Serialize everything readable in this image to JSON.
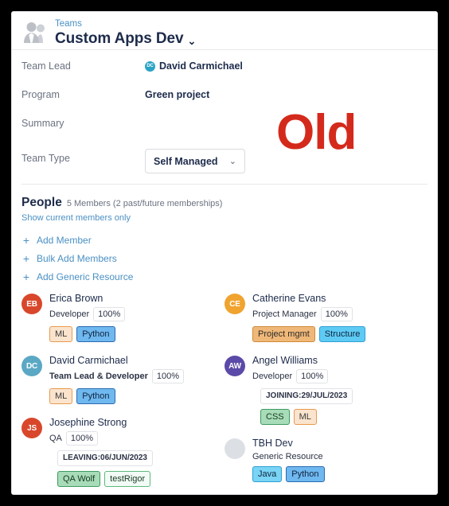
{
  "header": {
    "icon": "people-group-icon",
    "breadcrumb": "Teams",
    "title": "Custom Apps Dev",
    "chevron": "⌄"
  },
  "watermark": {
    "text": "Old",
    "color": "#d42a1c"
  },
  "fields": {
    "team_lead": {
      "label": "Team Lead",
      "avatar_initials": "DC",
      "avatar_color": "#2aa3c4",
      "value": "David Carmichael"
    },
    "program": {
      "label": "Program",
      "value": "Green project"
    },
    "summary": {
      "label": "Summary",
      "value": ""
    },
    "team_type": {
      "label": "Team Type",
      "value": "Self Managed",
      "chevron": "⌄"
    }
  },
  "people": {
    "title": "People",
    "subtitle": "5 Members (2 past/future memberships)",
    "show_current_link": "Show current members only",
    "actions": [
      {
        "icon": "plus-icon",
        "label": "Add Member"
      },
      {
        "icon": "plus-icon",
        "label": "Bulk Add Members"
      },
      {
        "icon": "plus-icon",
        "label": "Add Generic Resource"
      }
    ],
    "members_left": [
      {
        "initials": "EB",
        "avatar_color": "#d9472b",
        "name": "Erica Brown",
        "role": "Developer",
        "role_bold": false,
        "percent": "100%",
        "date_badge": "",
        "tags": [
          {
            "label": "ML",
            "bg": "#fae4ce",
            "border": "#e89a4e",
            "color": "#3a3a3a"
          },
          {
            "label": "Python",
            "bg": "#6fb8f0",
            "border": "#2b6cb0",
            "color": "#10243d"
          }
        ]
      },
      {
        "initials": "DC",
        "avatar_color": "#5ba8c4",
        "name": "David Carmichael",
        "role": "Team Lead & Developer",
        "role_bold": true,
        "percent": "100%",
        "date_badge": "",
        "tags": [
          {
            "label": "ML",
            "bg": "#fae4ce",
            "border": "#e89a4e",
            "color": "#3a3a3a"
          },
          {
            "label": "Python",
            "bg": "#6fb8f0",
            "border": "#2b6cb0",
            "color": "#10243d"
          }
        ]
      },
      {
        "initials": "JS",
        "avatar_color": "#d9472b",
        "name": "Josephine Strong",
        "role": "QA",
        "role_bold": false,
        "percent": "100%",
        "date_badge": "LEAVING:06/JUN/2023",
        "tags": [
          {
            "label": "QA Wolf",
            "bg": "#a8dcb8",
            "border": "#3f9960",
            "color": "#173a22"
          },
          {
            "label": "testRigor",
            "bg": "#f2fbf5",
            "border": "#5fb87c",
            "color": "#173a22"
          }
        ]
      }
    ],
    "members_right": [
      {
        "initials": "CE",
        "avatar_color": "#f0a32e",
        "name": "Catherine Evans",
        "role": "Project Manager",
        "role_bold": false,
        "percent": "100%",
        "date_badge": "",
        "tags": [
          {
            "label": "Project mgmt",
            "bg": "#f0b878",
            "border": "#cf8a3a",
            "color": "#2b2b2b"
          },
          {
            "label": "Structure",
            "bg": "#5ecbf5",
            "border": "#2f9fd4",
            "color": "#10243d"
          }
        ]
      },
      {
        "initials": "AW",
        "avatar_color": "#5b4aa8",
        "name": "Angel Williams",
        "role": "Developer",
        "role_bold": false,
        "percent": "100%",
        "date_badge": "JOINING:29/JUL/2023",
        "tags": [
          {
            "label": "CSS",
            "bg": "#a8dcb8",
            "border": "#3f9960",
            "color": "#173a22"
          },
          {
            "label": "ML",
            "bg": "#fae4ce",
            "border": "#e89a4e",
            "color": "#3a3a3a"
          }
        ]
      },
      {
        "initials": "",
        "avatar_color": "#dcdfe4",
        "name": "TBH Dev",
        "role": "Generic Resource",
        "role_bold": false,
        "percent": "",
        "date_badge": "",
        "tags": [
          {
            "label": "Java",
            "bg": "#79d4f5",
            "border": "#2f9fd4",
            "color": "#10243d"
          },
          {
            "label": "Python",
            "bg": "#6fb8f0",
            "border": "#2b6cb0",
            "color": "#10243d"
          }
        ]
      }
    ]
  }
}
